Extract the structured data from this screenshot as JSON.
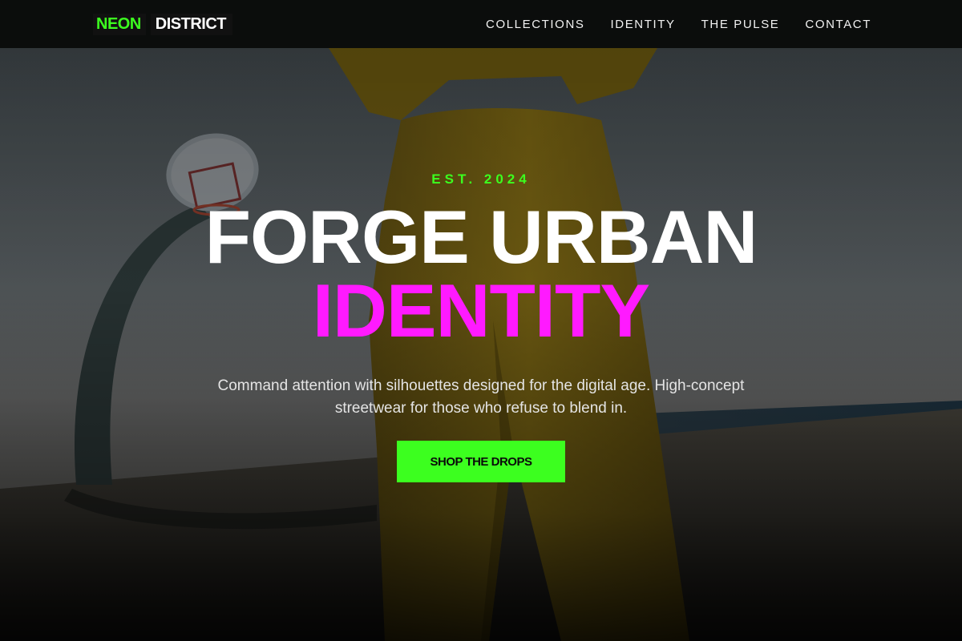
{
  "brand": {
    "name_part1": "NEON",
    "name_part2": "DISTRICT",
    "accent_color": "#3cff1f",
    "highlight_color": "#ff1aff"
  },
  "nav": {
    "items": [
      {
        "label": "COLLECTIONS"
      },
      {
        "label": "IDENTITY"
      },
      {
        "label": "THE PULSE"
      },
      {
        "label": "CONTACT"
      }
    ]
  },
  "hero": {
    "eyebrow": "EST. 2024",
    "headline_line1": "FORGE URBAN",
    "headline_line2": "IDENTITY",
    "subtext": "Command attention with silhouettes designed for the digital age. High-concept streetwear for those who refuse to blend in.",
    "cta_label": "SHOP THE DROPS"
  }
}
